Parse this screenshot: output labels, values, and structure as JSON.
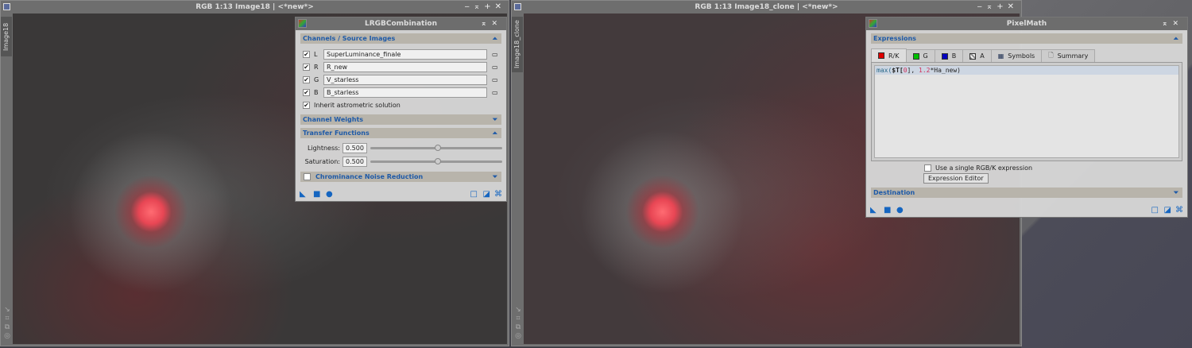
{
  "windows": [
    {
      "title": "RGB 1:13 Image18 | <*new*>",
      "side_tab": "Image18",
      "controls": [
        "‒",
        "⌅",
        "+",
        "✕"
      ]
    },
    {
      "title": "RGB 1:13 Image18_clone | <*new*>",
      "side_tab": "Image18_clone",
      "controls": [
        "‒",
        "⌅",
        "+",
        "✕"
      ]
    }
  ],
  "lrgb": {
    "title": "LRGBCombination",
    "sections": {
      "channels": "Channels / Source Images",
      "weights": "Channel Weights",
      "transfer": "Transfer Functions",
      "noise": "Chrominance Noise Reduction"
    },
    "channels": [
      {
        "label": "L",
        "value": "SuperLuminance_finale",
        "checked": true
      },
      {
        "label": "R",
        "value": "R_new",
        "checked": true
      },
      {
        "label": "G",
        "value": "V_starless",
        "checked": true
      },
      {
        "label": "B",
        "value": "B_starless",
        "checked": true
      }
    ],
    "inherit_label": "Inherit astrometric solution",
    "lightness_label": "Lightness:",
    "lightness": "0.500",
    "saturation_label": "Saturation:",
    "saturation": "0.500"
  },
  "pixelmath": {
    "title": "PixelMath",
    "sections": {
      "expressions": "Expressions",
      "destination": "Destination"
    },
    "tabs": [
      {
        "label": "R/K",
        "color": "#e00000"
      },
      {
        "label": "G",
        "color": "#00c000"
      },
      {
        "label": "B",
        "color": "#0000c0"
      },
      {
        "label": "A"
      },
      {
        "label": "Symbols"
      },
      {
        "label": "Summary"
      }
    ],
    "expr": {
      "fn": "max(",
      "var": "$T[",
      "idx": "0",
      "mid": "], ",
      "num": "1.2",
      "rest": "*Ha_new)"
    },
    "single_label": "Use a single RGB/K expression",
    "editor_button": "Expression Editor"
  }
}
